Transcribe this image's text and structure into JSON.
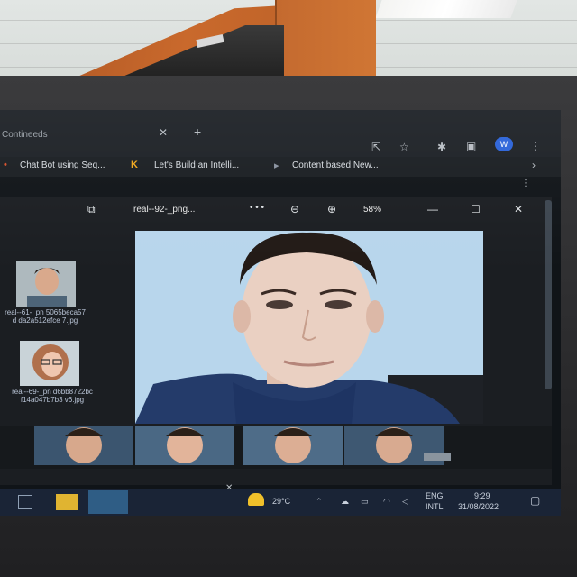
{
  "browser": {
    "tab_title": "Contineeds",
    "bookmarks": [
      {
        "label": "Chat Bot using Seq...",
        "icon": "bookmark-icon"
      },
      {
        "label": "Let's Build an Intelli...",
        "icon": "k-logo-icon"
      },
      {
        "label": "Content based New...",
        "icon": "bookmark-icon"
      }
    ],
    "profile_initial": "W"
  },
  "viewer": {
    "file_title": "real--92-_png...",
    "more": "• • •",
    "zoom_level": "58%"
  },
  "thumbnails": [
    {
      "caption": "real--61-_pn 5065beca57d da2a512efce 7.jpg"
    },
    {
      "caption": "real--69-_pn d6bb8722bc f14a047b7b3 v6.jpg"
    }
  ],
  "taskbar": {
    "weather": "29°C",
    "language_line1": "ENG",
    "language_line2": "INTL",
    "time": "9:29",
    "date": "31/08/2022"
  },
  "colors": {
    "screen_bg": "#101418",
    "taskbar": "#1a2436",
    "photo_bg": "#bcd9ef",
    "profile_badge": "#2b63d9"
  }
}
